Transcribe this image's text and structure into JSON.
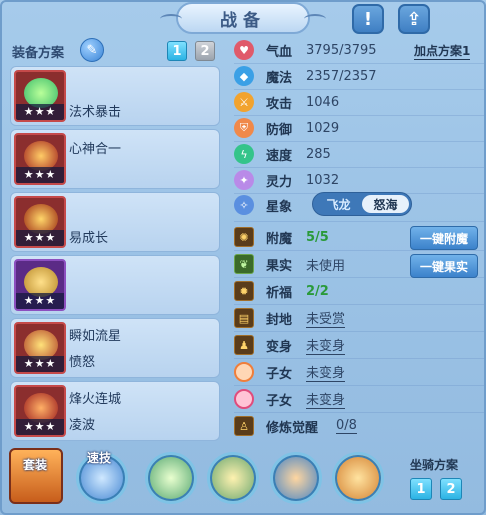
{
  "title": "战备",
  "header": {
    "info_icon": "exclamation-icon",
    "share_icon": "share-icon"
  },
  "left": {
    "header": "装备方案",
    "plan_tabs": [
      "1",
      "2"
    ],
    "items": [
      {
        "name": "法术暴击",
        "sub": "",
        "stars": "★★★"
      },
      {
        "name": "心神合一",
        "sub": "",
        "stars": "★★★"
      },
      {
        "name": "易成长",
        "sub": "",
        "stars": "★★★"
      },
      {
        "name": "",
        "sub": "",
        "stars": "★★★"
      },
      {
        "name": "瞬如流星",
        "sub": "愤怒",
        "stars": "★★★"
      },
      {
        "name": "烽火连城",
        "sub": "凌波",
        "stars": "★★★"
      }
    ]
  },
  "right": {
    "addpoints": "加点方案1",
    "stats": [
      {
        "label": "气血",
        "value": "3795/3795"
      },
      {
        "label": "魔法",
        "value": "2357/2357"
      },
      {
        "label": "攻击",
        "value": "1046"
      },
      {
        "label": "防御",
        "value": "1029"
      },
      {
        "label": "速度",
        "value": "285"
      },
      {
        "label": "灵力",
        "value": "1032"
      }
    ],
    "star": {
      "label": "星象",
      "options": [
        "飞龙",
        "怒海"
      ],
      "selected": "怒海"
    },
    "extras": [
      {
        "label": "附魔",
        "value": "5/5"
      },
      {
        "label": "果实",
        "value": "未使用"
      },
      {
        "label": "祈福",
        "value": "2/2"
      },
      {
        "label": "封地",
        "value": "未受赏"
      },
      {
        "label": "变身",
        "value": "未变身"
      },
      {
        "label": "子女",
        "value": "未变身"
      },
      {
        "label": "子女",
        "value": "未变身"
      },
      {
        "label": "修炼觉醒",
        "value": "0/8"
      }
    ],
    "buttons": {
      "enchant": "一键附魔",
      "fruit": "一键果实"
    }
  },
  "bottom": {
    "suit_label": "套装",
    "speed_label": "速技",
    "mount_label": "坐骑方案",
    "mount_tabs": [
      "1",
      "2"
    ]
  }
}
